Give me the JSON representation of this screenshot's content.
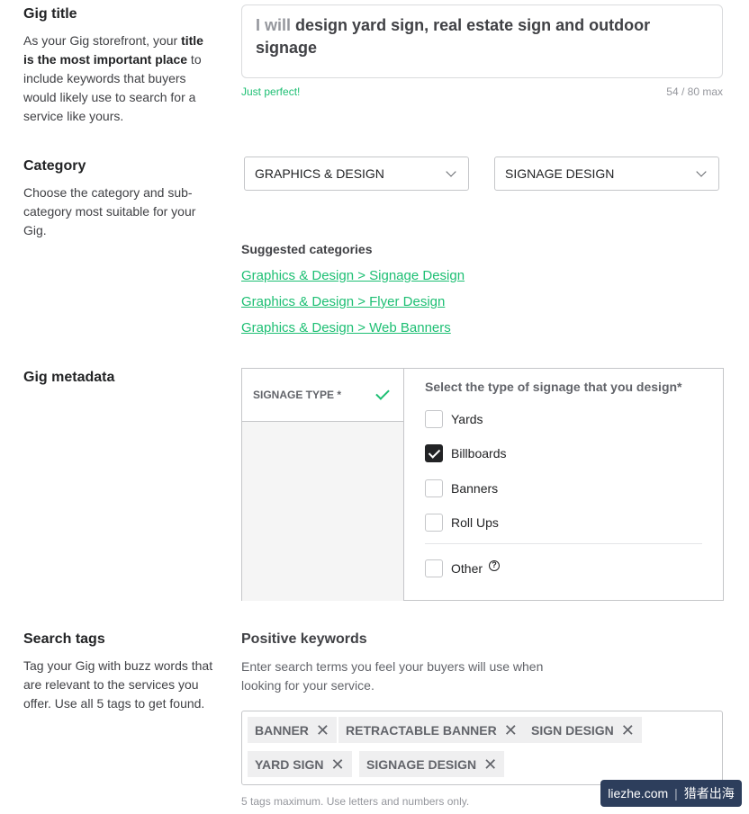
{
  "gig_title": {
    "heading": "Gig title",
    "desc_1": "As your Gig storefront, your ",
    "desc_bold": "title is the most important place",
    "desc_2": " to include keywords that buyers would likely use to search for a service like yours.",
    "prefix": "I will",
    "value": "design yard sign, real estate sign and outdoor signage",
    "hint": "Just perfect!",
    "count": "54 / 80 max"
  },
  "category": {
    "heading": "Category",
    "desc": "Choose the category and sub-category most suitable for your Gig.",
    "main_select": "GRAPHICS & DESIGN",
    "sub_select": "SIGNAGE DESIGN",
    "suggested_heading": "Suggested categories",
    "suggestions": [
      "Graphics & Design > Signage Design",
      "Graphics & Design > Flyer Design",
      "Graphics & Design > Web Banners"
    ]
  },
  "metadata": {
    "heading": "Gig metadata",
    "tab_label": "SIGNAGE TYPE *",
    "question": "Select the type of signage that you design*",
    "options": [
      {
        "label": "Yards",
        "checked": false
      },
      {
        "label": "Billboards",
        "checked": true
      },
      {
        "label": "Banners",
        "checked": false
      },
      {
        "label": "Roll Ups",
        "checked": false
      },
      {
        "label": "Other",
        "checked": false
      }
    ],
    "help_glyph": "?"
  },
  "search_tags": {
    "heading": "Search tags",
    "desc": "Tag your Gig with buzz words that are relevant to the services you offer. Use all 5 tags to get found.",
    "kw_title": "Positive keywords",
    "kw_desc": "Enter search terms you feel your buyers will use when looking for your service.",
    "tags": [
      "BANNER",
      "RETRACTABLE BANNER",
      "SIGN DESIGN",
      "YARD SIGN",
      "SIGNAGE DESIGN"
    ],
    "remove_glyph": "✕",
    "note": "5 tags maximum. Use letters and numbers only."
  },
  "watermark": {
    "left": "liezhe.com",
    "sep": "|",
    "right": "猎者出海"
  },
  "colors": {
    "accent": "#1dbf73",
    "text": "#404145"
  }
}
